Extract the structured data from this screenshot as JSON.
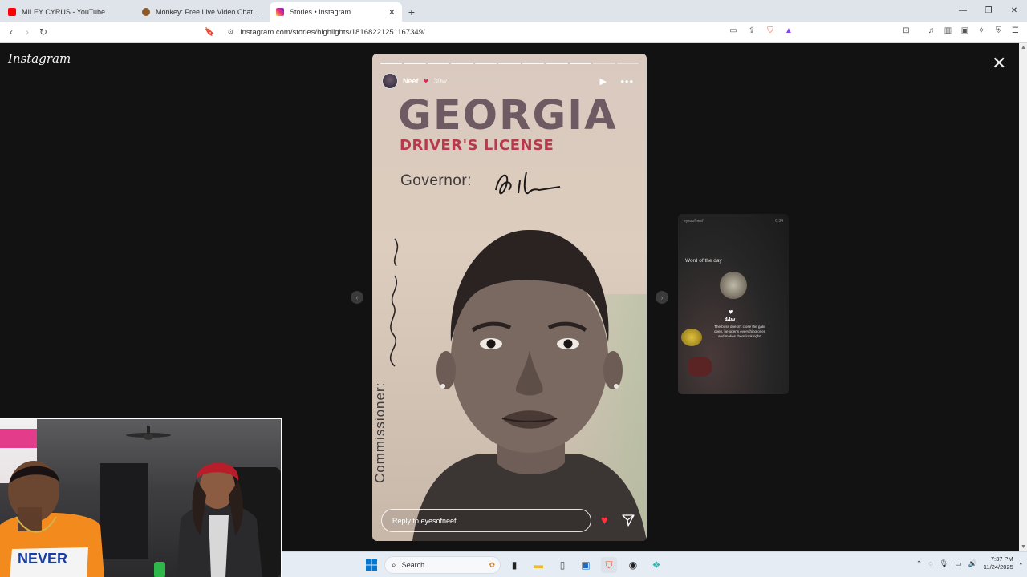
{
  "browser": {
    "tabs": [
      {
        "label": "MILEY CYRUS - YouTube",
        "favicon_color": "#ff0000",
        "active": false
      },
      {
        "label": "Monkey: Free Live Video Chat to Me",
        "favicon_color": "#8a5a2b",
        "active": false
      },
      {
        "label": "Stories • Instagram",
        "favicon_color": "#d62976",
        "active": true
      }
    ],
    "new_tab_symbol": "+",
    "url": "instagram.com/stories/highlights/18168221251167349/"
  },
  "instagram": {
    "logo": "Instagram",
    "story": {
      "username": "Neef",
      "time_ago": "30w",
      "progress_total": 11,
      "progress_filled": 9,
      "reply_placeholder": "Reply to eyesofneef...",
      "license": {
        "state": "GEORGIA",
        "type": "DRIVER'S LICENSE",
        "governor_label": "Governor:",
        "commissioner_label": "Commissioner:"
      }
    },
    "next_story": {
      "username": "eyesofneef",
      "time": "0:34",
      "word_title": "Word of the day",
      "count": "44w",
      "caption": "The boss doesn't close the gate open, he opens everything ones and makes them look right."
    },
    "colors": {
      "accent_like": "#ff3040",
      "state_text": "#6e5a62",
      "license_red": "#b53a4c"
    }
  },
  "taskbar": {
    "search_label": "Search",
    "time": "7:37 PM",
    "date": "11/24/2025"
  }
}
